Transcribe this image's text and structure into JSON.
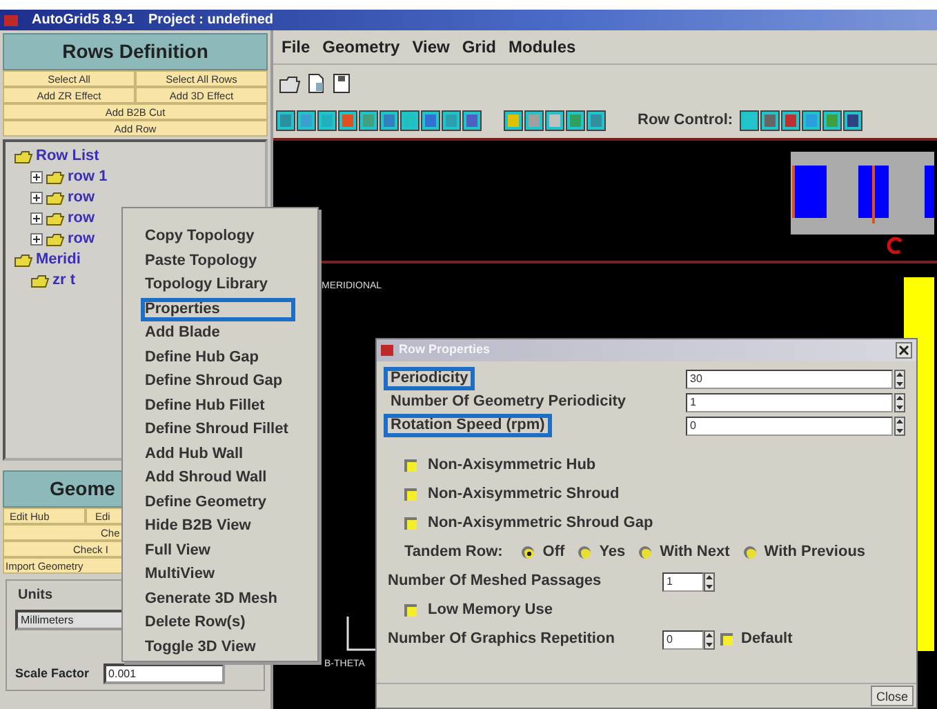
{
  "window": {
    "app": "AutoGrid5 8.9-1",
    "project": "Project : undefined"
  },
  "rows_panel": {
    "header": "Rows Definition",
    "button_rows": [
      [
        "Select All",
        "Select All Rows"
      ],
      [
        "Add ZR Effect",
        "Add 3D Effect"
      ],
      [
        "Add B2B Cut"
      ],
      [
        "Add Row"
      ]
    ],
    "tree": [
      {
        "label": "Row List",
        "children": [
          {
            "label": "row 1",
            "expanded": false
          },
          {
            "label": "row",
            "expanded": false
          },
          {
            "label": "row",
            "expanded": false
          },
          {
            "label": "row",
            "expanded": false
          }
        ]
      },
      {
        "label": "Meridi",
        "children": [
          {
            "label": "zr t"
          }
        ]
      }
    ]
  },
  "geometry_panel": {
    "header": "Geome",
    "button_rows": [
      [
        "Edit Hub",
        "Edi"
      ],
      [
        "Che"
      ],
      [
        "Check I"
      ],
      [
        "Import Geometry"
      ]
    ],
    "units": {
      "legend": "Units",
      "unit": "Millimeters",
      "scale_label": "Scale Factor",
      "scale_value": "0.001"
    }
  },
  "menu_bar": [
    "File",
    "Geometry",
    "View",
    "Grid",
    "Modules"
  ],
  "row_control_label": "Row Control:",
  "canvas": {
    "top_label": "MERIDIONAL",
    "bottom_label": "B-THETA"
  },
  "context_menu": [
    {
      "label": "Copy Topology",
      "highlighted": false
    },
    {
      "label": "Paste Topology",
      "highlighted": false
    },
    {
      "label": "Topology Library",
      "highlighted": false
    },
    {
      "label": "Properties",
      "highlighted": true
    },
    {
      "label": "Add Blade",
      "highlighted": false
    },
    {
      "label": "Define Hub Gap",
      "highlighted": false
    },
    {
      "label": "Define Shroud Gap",
      "highlighted": false
    },
    {
      "label": "Define Hub Fillet",
      "highlighted": false
    },
    {
      "label": "Define Shroud Fillet",
      "highlighted": false
    },
    {
      "label": "Add Hub Wall",
      "highlighted": false
    },
    {
      "label": "Add Shroud Wall",
      "highlighted": false
    },
    {
      "label": "Define Geometry",
      "highlighted": false
    },
    {
      "label": "Hide B2B View",
      "highlighted": false
    },
    {
      "label": "Full View",
      "highlighted": false
    },
    {
      "label": "MultiView",
      "highlighted": false
    },
    {
      "label": "Generate 3D Mesh",
      "highlighted": false
    },
    {
      "label": "Delete Row(s)",
      "highlighted": false
    },
    {
      "label": "Toggle 3D View",
      "highlighted": false
    }
  ],
  "dialog": {
    "title": "Row Properties",
    "close_button": "Close",
    "items": [
      {
        "kind": "field",
        "label": "Periodicity",
        "value": "30",
        "highlighted": true
      },
      {
        "kind": "field",
        "label": "Number Of Geometry Periodicity",
        "value": "1",
        "highlighted": false
      },
      {
        "kind": "field",
        "label": "Rotation Speed (rpm)",
        "value": "0",
        "highlighted": true
      },
      {
        "kind": "checkbox",
        "label": "Non-Axisymmetric Hub",
        "checked": false
      },
      {
        "kind": "checkbox",
        "label": "Non-Axisymmetric Shroud",
        "checked": false
      },
      {
        "kind": "checkbox",
        "label": "Non-Axisymmetric Shroud Gap",
        "checked": false
      },
      {
        "kind": "radio",
        "label": "Tandem Row:",
        "options": [
          {
            "label": "Off",
            "selected": true
          },
          {
            "label": "Yes",
            "selected": false
          },
          {
            "label": "With Next",
            "selected": false
          },
          {
            "label": "With Previous",
            "selected": false
          }
        ]
      },
      {
        "kind": "spinner",
        "label": "Number Of Meshed Passages",
        "value": "1"
      },
      {
        "kind": "checkbox",
        "label": "Low Memory Use",
        "checked": false
      },
      {
        "kind": "spinner",
        "label": "Number Of Graphics Repetition",
        "value": "0",
        "check_label": "Default",
        "checked": false
      }
    ]
  }
}
